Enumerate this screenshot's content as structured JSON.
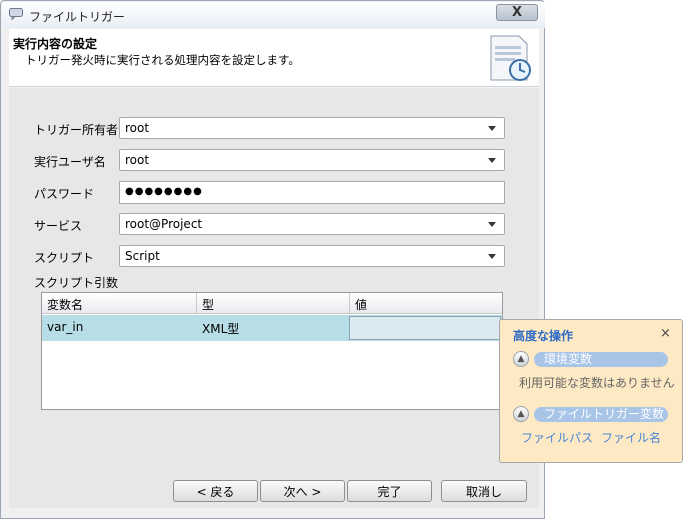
{
  "window": {
    "title": "ファイルトリガー",
    "close": "X"
  },
  "header": {
    "title": "実行内容の設定",
    "description": "トリガー発火時に実行される処理内容を設定します。"
  },
  "form": {
    "owner": {
      "label": "トリガー所有者",
      "value": "root"
    },
    "exec_user": {
      "label": "実行ユーザ名",
      "value": "root"
    },
    "password": {
      "label": "パスワード",
      "value": "●●●●●●●●"
    },
    "service": {
      "label": "サービス",
      "value": "root@Project"
    },
    "script": {
      "label": "スクリプト",
      "value": "Script"
    },
    "args_label": "スクリプト引数"
  },
  "table": {
    "columns": [
      "変数名",
      "型",
      "値"
    ],
    "rows": [
      {
        "name": "var_in",
        "type": "XML型",
        "value": ""
      }
    ]
  },
  "buttons": {
    "back": "< 戻る",
    "next": "次へ >",
    "finish": "完了",
    "cancel": "取消し"
  },
  "popup": {
    "title": "高度な操作",
    "close": "×",
    "env_section": "環境変数",
    "env_empty": "利用可能な変数はありません",
    "trigger_section": "ファイルトリガー変数",
    "trigger_vars": [
      "ファイルパス",
      "ファイル名"
    ]
  },
  "colors": {
    "selected_row": "#b7dde7",
    "popup_bg": "#fde9c4",
    "link": "#4a86d6",
    "popup_title": "#2e6bc6"
  }
}
